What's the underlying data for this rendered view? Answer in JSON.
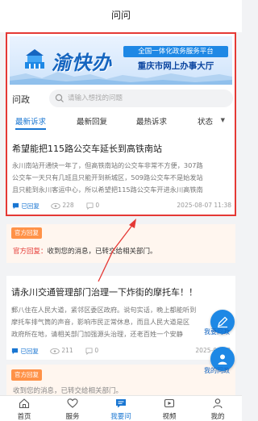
{
  "page": {
    "title": "问问"
  },
  "banner": {
    "logo_text": "渝快办",
    "sub_text": "全国一体化政务服务平台",
    "main_text": "重庆市网上办事大厅"
  },
  "search": {
    "label": "问政",
    "placeholder": "请输入想找的问题"
  },
  "tabs": [
    {
      "label": "最新诉求"
    },
    {
      "label": "最新回复"
    },
    {
      "label": "最热诉求"
    },
    {
      "label": "状态"
    }
  ],
  "colors": {
    "accent": "#1976d2",
    "highlight": "#e53935",
    "reply_tag": "#ff9248"
  },
  "posts": [
    {
      "title": "希望能把115路公交车延长到高铁南站",
      "body_lines": [
        "永川南站开通快一年了，但高铁南站的公交车非常不方便，307路",
        "公交车一天只有几班且只能开到新城区，509路公交车不是始发站",
        "且只能到永川客运中心，所以希望把115路公交车开进永川高铁南"
      ],
      "status": "已回复",
      "views": "228",
      "comments": "0",
      "date": "2025-08-07 11:38",
      "reply_tag": "官方回复",
      "reply_prefix": "官方回复：",
      "reply_text": "收到您的消息，已转交给相关部门。"
    },
    {
      "title": "请永川交通管理部门治理一下炸街的摩托车！！",
      "body_lines": [
        "郵八住在人民大道，紧邻区委区政府。说句实话，晚上都能听到",
        "摩托车排气筒的声音，影响市民正常休息，而且人民大道是区",
        "政府所在地，请相关部门加强源头治理，还老百姓一个安静"
      ],
      "status": "已回复",
      "views": "211",
      "comments": "0",
      "date": "2025-06-13 ",
      "reply_tag": "官方回复",
      "reply_text": "收到您的消息，已转交给相关部门。"
    }
  ],
  "float_buttons": [
    {
      "label": "我要问政",
      "icon": "pen-icon"
    },
    {
      "label": "我的问政",
      "icon": "user-icon"
    }
  ],
  "bottom_nav": [
    {
      "label": "首页",
      "icon": "home-icon"
    },
    {
      "label": "服务",
      "icon": "heart-icon"
    },
    {
      "label": "我要问",
      "icon": "chat-icon",
      "active": true
    },
    {
      "label": "视频",
      "icon": "video-icon"
    },
    {
      "label": "我的",
      "icon": "profile-icon"
    }
  ]
}
